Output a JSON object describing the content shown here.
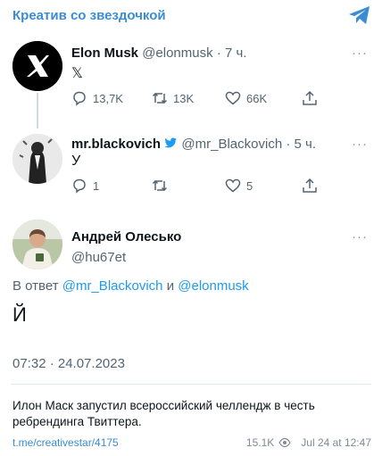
{
  "channel": {
    "title": "Креатив со звездочкой"
  },
  "tweets": [
    {
      "name": "Elon Musk",
      "handle": "@elonmusk",
      "time": "· 7 ч.",
      "text": "𝕏",
      "replies": "13,7K",
      "retweets": "13K",
      "likes": "66K"
    },
    {
      "name": "mr.blackovich",
      "handle": "@mr_Blackovich",
      "time": "· 5 ч.",
      "text": "У",
      "replies": "1",
      "retweets": "",
      "likes": "5"
    },
    {
      "name": "Андрей Олесько",
      "handle": "@hu67et"
    }
  ],
  "reply": {
    "prefix": "В ответ",
    "mention1": "@mr_Blackovich",
    "conj": "и",
    "mention2": "@elonmusk"
  },
  "main_tweet": {
    "text": "Й",
    "timestamp": "07:32 · 24.07.2023"
  },
  "post": {
    "caption": "Илон Маск запустил всероссийский челлендж в честь ребрендинга Твиттера.",
    "link": "t.me/creativestar/4175",
    "views": "15.1K",
    "date": "Jul 24 at 12:47"
  },
  "more_glyph": "···",
  "colors": {
    "channel": "#3a8cd3",
    "link": "#1d9bf0",
    "muted": "#536471"
  }
}
